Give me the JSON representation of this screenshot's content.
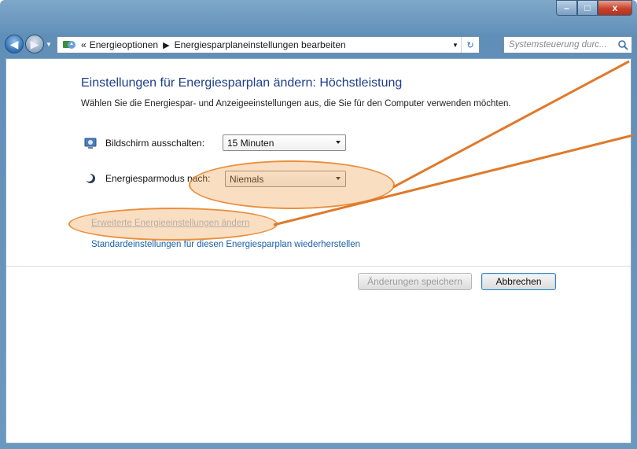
{
  "window": {
    "controls": {
      "minimize": "–",
      "maximize": "□",
      "close": "x"
    }
  },
  "navbar": {
    "breadcrumb_prefix": "«",
    "crumbs": [
      "Energieoptionen",
      "Energiesparplaneinstellungen bearbeiten"
    ],
    "search_placeholder": "Systemsteuerung durc..."
  },
  "main": {
    "title": "Einstellungen für Energiesparplan ändern: Höchstleistung",
    "subtitle": "Wählen Sie die Energiespar- und Anzeigeeinstellungen aus, die Sie für den Computer verwenden möchten.",
    "display_off": {
      "label": "Bildschirm ausschalten:",
      "value": "15 Minuten"
    },
    "sleep": {
      "label": "Energiesparmodus nach:",
      "value": "Niemals"
    },
    "link_advanced": "Erweiterte Energieeinstellungen ändern",
    "link_restore": "Standardeinstellungen für diesen Energiesparplan wiederherstellen",
    "btn_save": "Änderungen speichern",
    "btn_cancel": "Abbrechen"
  },
  "colors": {
    "accent": "#1e3f8a",
    "link": "#1a5fa8",
    "highlight": "#e8822a"
  }
}
